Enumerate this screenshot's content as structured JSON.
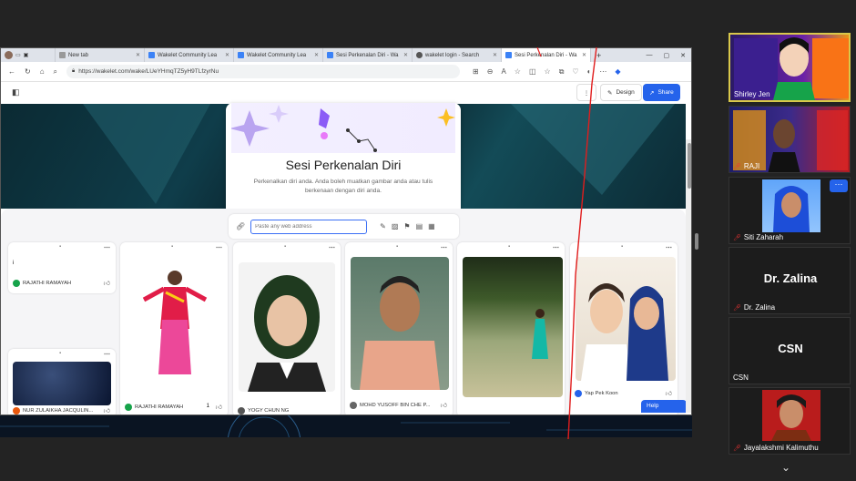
{
  "browser": {
    "tabs": [
      {
        "label": "New tab"
      },
      {
        "label": "Wakelet Community Lea"
      },
      {
        "label": "Wakelet Community Lea"
      },
      {
        "label": "Sesi Perkenalan Diri - Wa"
      },
      {
        "label": "wakelet login - Search"
      },
      {
        "label": "Sesi Perkenalan Diri - Wa"
      }
    ],
    "url": "https://wakelet.com/wake/LUeYHmqTZ5yH9TLfzyrNu"
  },
  "toolbar": {
    "design_label": "Design",
    "share_label": "Share"
  },
  "card": {
    "title": "Sesi Perkenalan Diri",
    "description": "Perkenalkan diri anda. Anda boleh muatkan gambar anda atau tulis berkenaan dengan diri anda."
  },
  "adder": {
    "placeholder": "Paste any web address"
  },
  "posts": [
    {
      "author": "RAJATHI RAMAYAH",
      "text": "i"
    },
    {
      "author": "NUR ZULAIKHA JACQULIN..."
    },
    {
      "author": "RAJATHI RAMAYAH",
      "likes": "1"
    },
    {
      "author": "YOGY CHUN NG"
    },
    {
      "author": "MOHD YUSOFF BIN CHE P..."
    },
    {
      "author": "Yap Pek Koon"
    }
  ],
  "help_label": "Help",
  "participants": [
    {
      "name": "Shirley Jen"
    },
    {
      "name": "RAJI"
    },
    {
      "name": "Siti Zaharah"
    },
    {
      "name": "Dr. Zalina",
      "big": "Dr. Zalina"
    },
    {
      "name": "CSN",
      "big": "CSN"
    },
    {
      "name": "Jayalakshmi Kalimuthu"
    }
  ],
  "colors": {
    "accent": "#2563eb",
    "hero": "#0f3d4a"
  }
}
